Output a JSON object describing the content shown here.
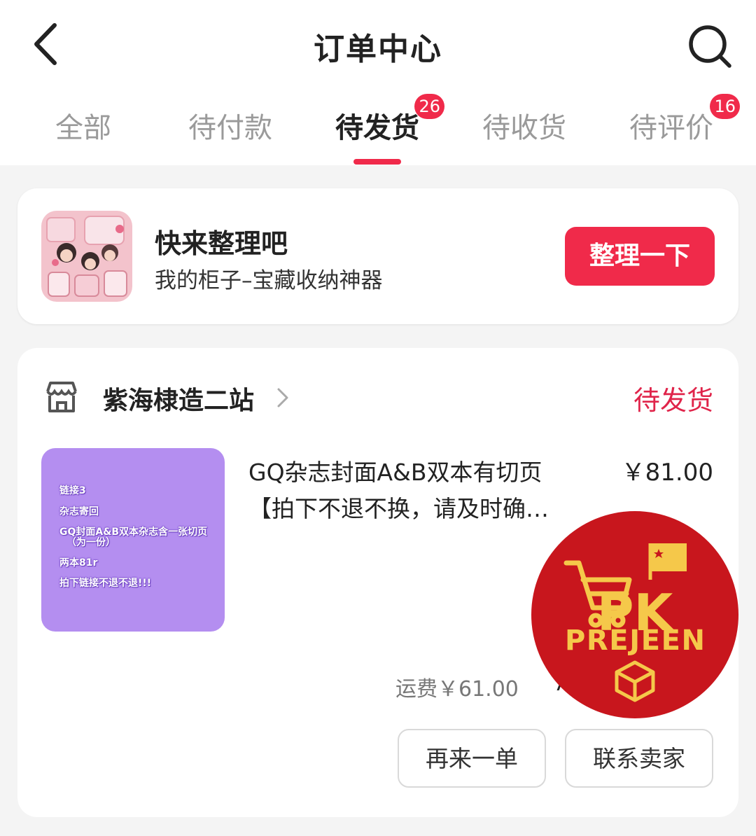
{
  "header": {
    "title": "订单中心",
    "back_icon": "chevron-left-icon",
    "search_icon": "search-icon"
  },
  "tabs": [
    {
      "label": "全部",
      "badge": null,
      "active": false
    },
    {
      "label": "待付款",
      "badge": null,
      "active": false
    },
    {
      "label": "待发货",
      "badge": "26",
      "active": true
    },
    {
      "label": "待收货",
      "badge": null,
      "active": false
    },
    {
      "label": "待评价",
      "badge": "16",
      "active": false
    }
  ],
  "promo": {
    "title": "快来整理吧",
    "subtitle": "我的柜子–宝藏收纳神器",
    "button_label": "整理一下"
  },
  "order": {
    "store_name": "紫海棣造二站",
    "status": "待发货",
    "thumbnail_lines": [
      "链接3",
      "杂志寄回",
      "GQ封面A&B双本杂志含一张切页",
      "（为一份）",
      "两本81r",
      "拍下链接不退不退!!!"
    ],
    "product_title_line1": "GQ杂志封面A&B双本有切页",
    "product_title_line2": "【拍下不退不换，请及时确…",
    "price": "￥81.00",
    "shipping": "运费￥61.00",
    "total_partial": "7",
    "actions": {
      "reorder_label": "再来一单",
      "contact_label": "联系卖家"
    }
  },
  "watermark": {
    "line1": "PK",
    "line2": "PREJEEN"
  },
  "colors": {
    "accent": "#f02a4a",
    "status_red": "#e0244a",
    "watermark_red": "#c8161d",
    "watermark_gold": "#f5c84a",
    "thumb_purple": "#b48ef0"
  }
}
